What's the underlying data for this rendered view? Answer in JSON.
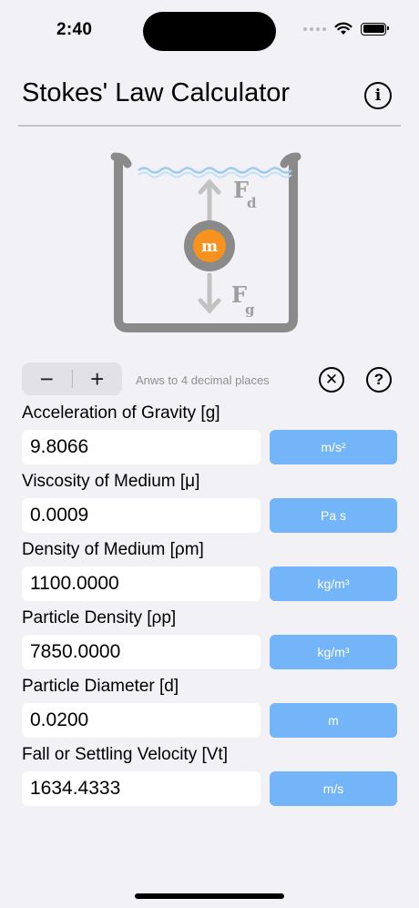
{
  "status": {
    "time": "2:40"
  },
  "nav": {
    "title": "Stokes' Law Calculator"
  },
  "diagram": {
    "drag_force_symbol": "F",
    "drag_force_sub": "d",
    "gravity_force_symbol": "F",
    "gravity_force_sub": "g",
    "mass_symbol": "m",
    "colors": {
      "container": "#8a8a8a",
      "water": "#9ecbf0",
      "arrow": "#c2c2c2",
      "particle": "#f7921e"
    }
  },
  "controls": {
    "decrement_label": "−",
    "increment_label": "+",
    "precision_text": "Anws to 4 decimal places"
  },
  "fields": [
    {
      "label": "Acceleration of Gravity [g]",
      "value": "9.8066",
      "unit": "m/s²"
    },
    {
      "label": "Viscosity of Medium [μ]",
      "value": "0.0009",
      "unit": "Pa s"
    },
    {
      "label": "Density of Medium [ρm]",
      "value": "1100.0000",
      "unit": "kg/m³"
    },
    {
      "label": "Particle Density [ρp]",
      "value": "7850.0000",
      "unit": "kg/m³"
    },
    {
      "label": "Particle Diameter [d]",
      "value": "0.0200",
      "unit": "m"
    },
    {
      "label": "Fall or Settling Velocity [Vt]",
      "value": "1634.4333",
      "unit": "m/s"
    }
  ],
  "accent_color": "#74b5fa"
}
